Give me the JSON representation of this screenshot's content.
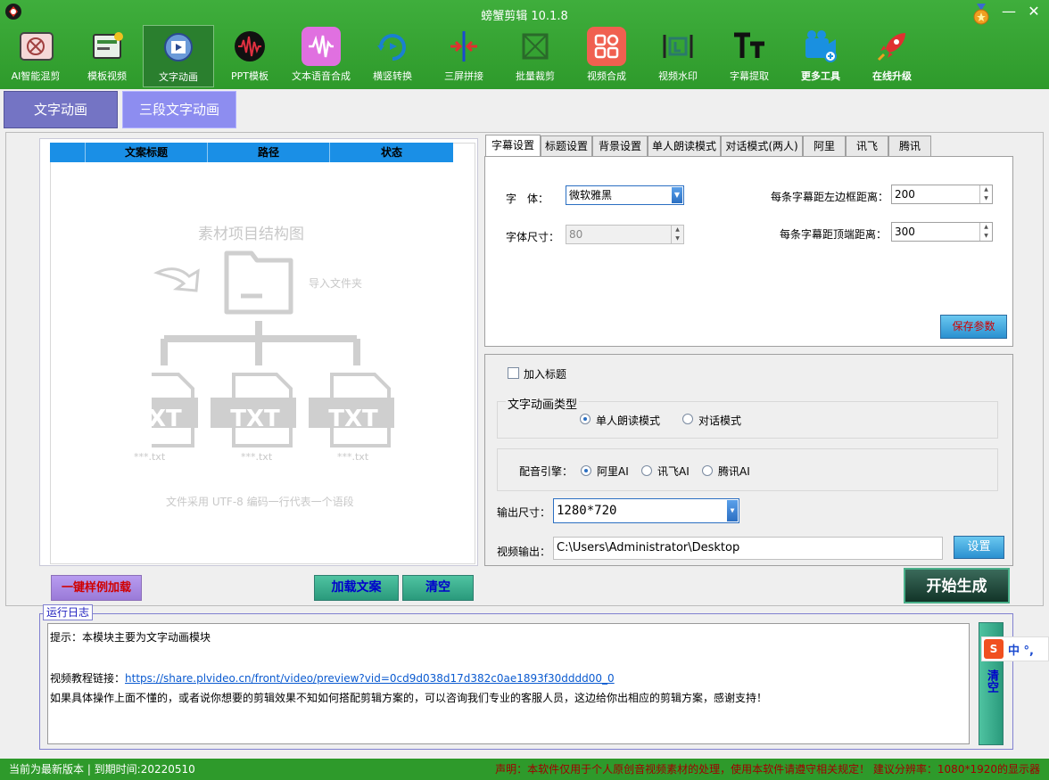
{
  "window": {
    "title": "螃蟹剪辑 10.1.8",
    "minimize": "—",
    "close": "✕"
  },
  "toolbar": [
    {
      "label": "AI智能混剪",
      "icon": "ai-mix-icon",
      "color": "#e8b0b0"
    },
    {
      "label": "模板视频",
      "icon": "template-icon",
      "color": "#5a7a5a"
    },
    {
      "label": "文字动画",
      "icon": "text-anim-icon",
      "color": "#4a7ac0"
    },
    {
      "label": "PPT模板",
      "icon": "ppt-icon",
      "color": "#222222"
    },
    {
      "label": "文本语音合成",
      "icon": "tts-icon",
      "color": "#e070e0"
    },
    {
      "label": "横竖转换",
      "icon": "rotate-icon",
      "color": "#1a80d0"
    },
    {
      "label": "三屏拼接",
      "icon": "split-icon",
      "color": "#1a4ad0"
    },
    {
      "label": "批量裁剪",
      "icon": "crop-icon",
      "color": "#2a7a2a"
    },
    {
      "label": "视频合成",
      "icon": "compose-icon",
      "color": "#f06050"
    },
    {
      "label": "视频水印",
      "icon": "watermark-icon",
      "color": "#222222"
    },
    {
      "label": "字幕提取",
      "icon": "subtitle-icon",
      "color": "#111111"
    },
    {
      "label": "更多工具",
      "icon": "more-tools-icon",
      "color": "#1a90e0"
    },
    {
      "label": "在线升级",
      "icon": "upgrade-icon",
      "color": "#e03030"
    }
  ],
  "modes": {
    "tab1": "文字动画",
    "tab2": "三段文字动画"
  },
  "table": {
    "headers": [
      "文案标题",
      "路径",
      "状态"
    ],
    "placeholder_title": "素材项目结构图",
    "placeholder_import": "导入文件夹",
    "txt": "TXT",
    "file": "***.txt",
    "placeholder_note": "文件采用 UTF-8 编码一行代表一个语段"
  },
  "left_buttons": {
    "sample": "一键样例加载",
    "load": "加载文案",
    "clear": "清空"
  },
  "settings_tabs": [
    "字幕设置",
    "标题设置",
    "背景设置",
    "单人朗读模式",
    "对话模式(两人)",
    "阿里",
    "讯飞",
    "腾讯"
  ],
  "subtitle": {
    "font_label": "字　体：",
    "font_value": "微软雅黑",
    "size_label": "字体尺寸：",
    "size_value": "80",
    "left_label": "每条字幕距左边框距离：",
    "left_value": "200",
    "top_label": "每条字幕距顶端距离：",
    "top_value": "300",
    "save": "保存参数"
  },
  "options": {
    "add_title": "加入标题",
    "anim_type_label": "文字动画类型",
    "mode_single": "单人朗读模式",
    "mode_dialog": "对话模式",
    "engine_label": "配音引擎：",
    "engine_ali": "阿里AI",
    "engine_xf": "讯飞AI",
    "engine_tx": "腾讯AI",
    "output_size_label": "输出尺寸：",
    "output_size": "1280*720",
    "video_out_label": "视频输出：",
    "video_out": "C:\\Users\\Administrator\\Desktop",
    "settings_btn": "设置"
  },
  "start": "开始生成",
  "log": {
    "legend": "运行日志",
    "line1": "提示：本模块主要为文字动画模块",
    "link_label": "视频教程链接：",
    "link": "https://share.plvideo.cn/front/video/preview?vid=0cd9d038d17d382c0ae1893f30dddd00_0",
    "line3": "如果具体操作上面不懂的，或者说你想要的剪辑效果不知如何搭配剪辑方案的，可以咨询我们专业的客服人员，这边给你出相应的剪辑方案，感谢支持！",
    "clear": "清空"
  },
  "ime": {
    "s": "S",
    "text": "中 °,"
  },
  "status": {
    "left": "当前为最新版本 | 到期时间:20220510",
    "right": "声明：本软件仅用于个人原创音视频素材的处理，使用本软件请遵守相关规定！ 建议分辨率：1080*1920的显示器"
  }
}
